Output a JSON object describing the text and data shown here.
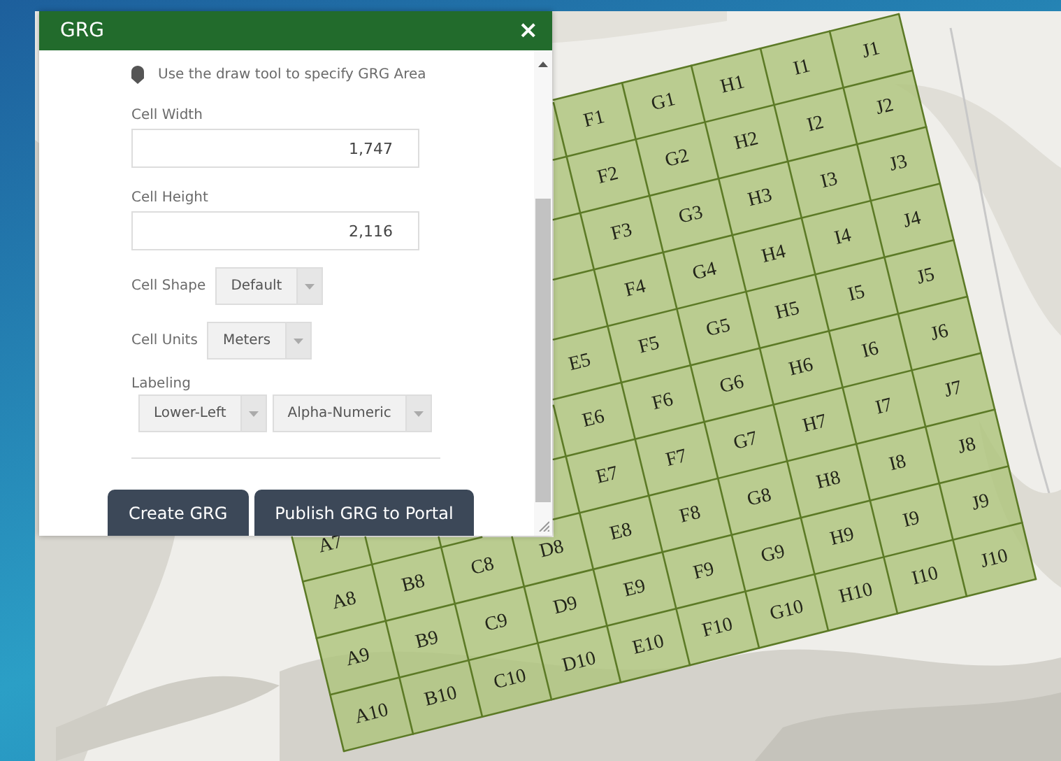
{
  "panel": {
    "title": "GRG",
    "close": "×",
    "hint": "Use the draw tool to specify GRG Area",
    "fields": [
      {
        "kind": "input",
        "label": "Cell Width",
        "value": "1,747"
      },
      {
        "kind": "input",
        "label": "Cell Height",
        "value": "2,116"
      },
      {
        "kind": "select",
        "label": "Cell Shape",
        "values": [
          "Default"
        ]
      },
      {
        "kind": "select",
        "label": "Cell Units",
        "values": [
          "Meters"
        ]
      },
      {
        "kind": "select-pair",
        "label": "Labeling",
        "values": [
          "Lower-Left",
          "Alpha-Numeric"
        ]
      }
    ],
    "buttons": [
      "Create GRG",
      "Publish GRG to Portal"
    ]
  },
  "grid": {
    "columns": [
      {
        "cells": [
          "A7",
          "A8",
          "A9",
          "A10"
        ]
      },
      {
        "cells": [
          "B8",
          "B9",
          "B10"
        ]
      },
      {
        "cells": [
          "C8",
          "C9",
          "C10"
        ]
      },
      {
        "cells": [
          "D8",
          "D9",
          "D10"
        ]
      },
      {
        "cells": [
          "E5",
          "E6",
          "E7",
          "E8",
          "E9",
          "E10"
        ]
      },
      {
        "cells": [
          "F1",
          "F2",
          "F3",
          "F4",
          "F5",
          "F6",
          "F7",
          "F8",
          "F9",
          "F10"
        ]
      },
      {
        "cells": [
          "G1",
          "G2",
          "G3",
          "G4",
          "G5",
          "G6",
          "G7",
          "G8",
          "G9",
          "G10"
        ]
      },
      {
        "cells": [
          "H1",
          "H2",
          "H3",
          "H4",
          "H5",
          "H6",
          "H7",
          "H8",
          "H9",
          "H10"
        ]
      },
      {
        "cells": [
          "I1",
          "I2",
          "I3",
          "I4",
          "I5",
          "I6",
          "I7",
          "I8",
          "I9",
          "I10"
        ]
      },
      {
        "cells": [
          "J1",
          "J2",
          "J3",
          "J4",
          "J5",
          "J6",
          "J7",
          "J8",
          "J9",
          "J10"
        ]
      }
    ]
  }
}
